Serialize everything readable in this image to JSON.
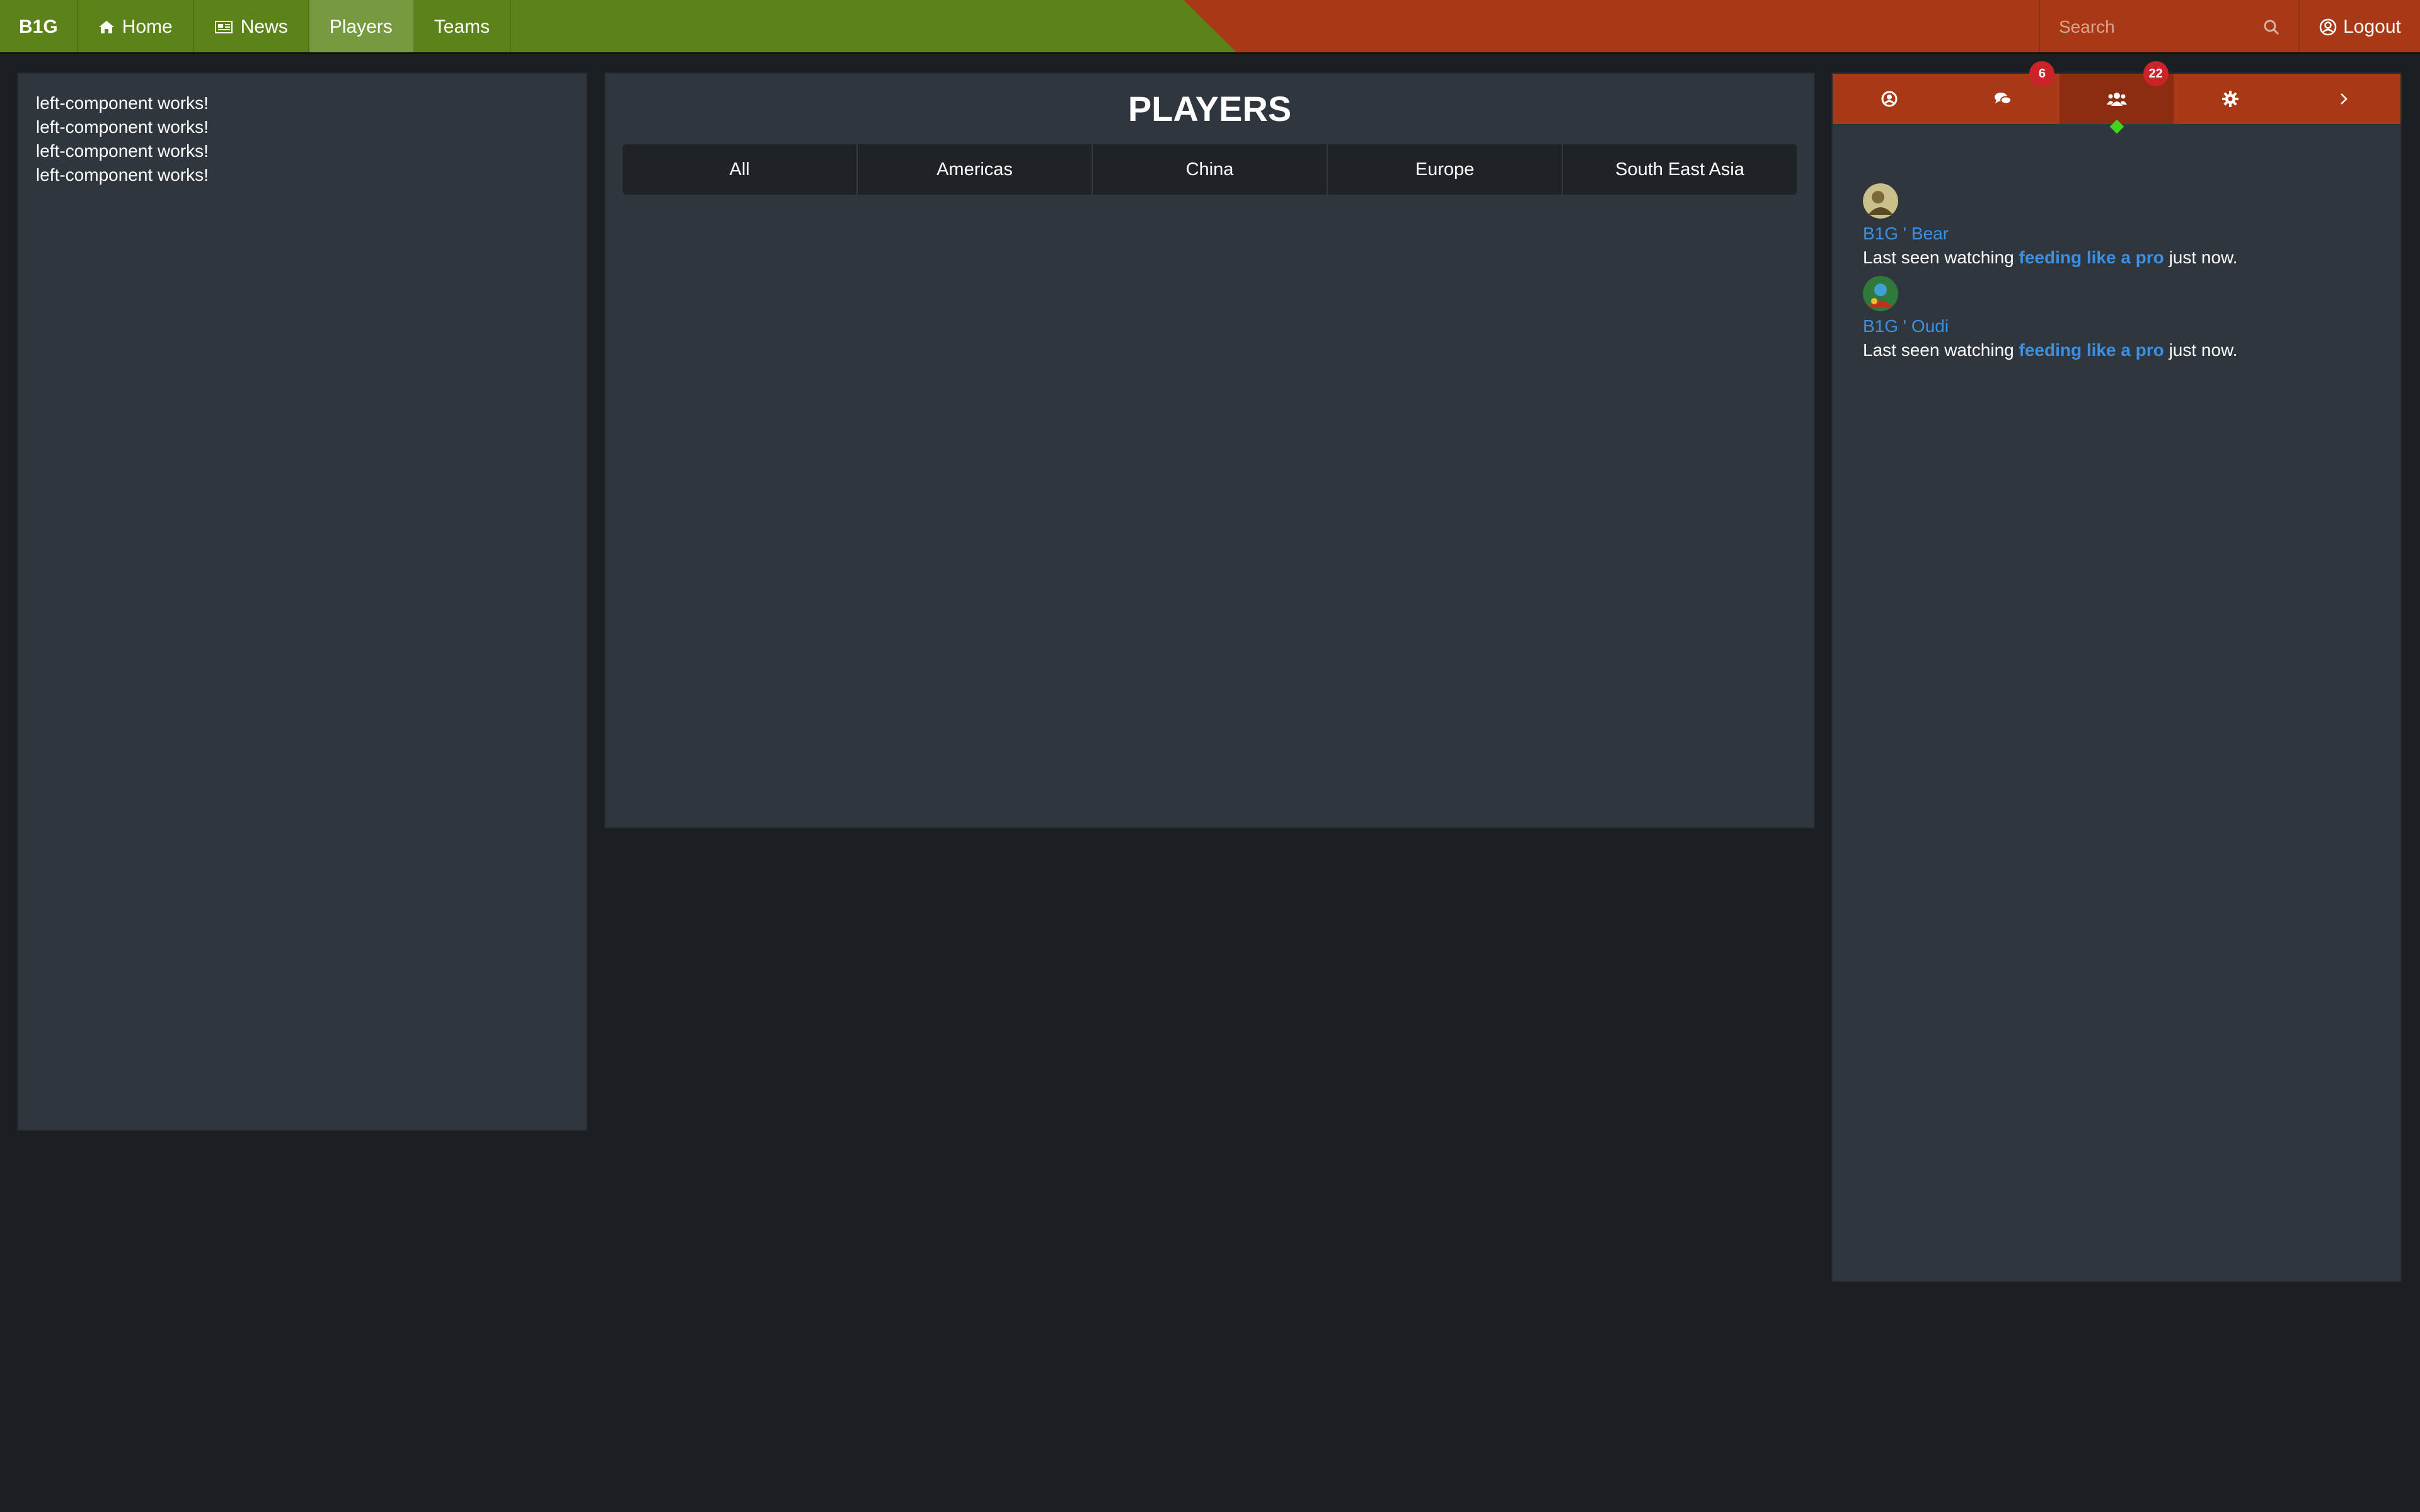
{
  "nav": {
    "brand": "B1G",
    "items": [
      {
        "label": "Home",
        "icon": "home-icon"
      },
      {
        "label": "News",
        "icon": "newspaper-icon"
      },
      {
        "label": "Players",
        "active": true
      },
      {
        "label": "Teams"
      }
    ],
    "search_placeholder": "Search",
    "logout_label": "Logout"
  },
  "colors": {
    "nav_green": "#5b831a",
    "nav_orange": "#a93916",
    "active_green": "#77993f",
    "panel": "#30363d",
    "background": "#1b1f22",
    "link_blue": "#3d8fe0",
    "badge_red": "#cc2229",
    "online_green": "#45d11f"
  },
  "left_panel": {
    "lines": [
      "left-component works!",
      "left-component works!",
      "left-component works!",
      "left-component works!"
    ]
  },
  "main": {
    "title": "PLAYERS",
    "tabs": [
      "All",
      "Americas",
      "China",
      "Europe",
      "South East Asia"
    ]
  },
  "sidebar": {
    "tabs": [
      {
        "icon": "user-circle-icon"
      },
      {
        "icon": "chat-bubbles-icon",
        "badge": "6"
      },
      {
        "icon": "users-icon",
        "badge": "22",
        "active": true
      },
      {
        "icon": "gear-icon"
      },
      {
        "icon": "chevron-right-icon"
      }
    ],
    "friends": [
      {
        "name": "B1G ' Bear",
        "status_prefix": "Last seen watching",
        "link": "feeding like a pro",
        "status_suffix": "just now."
      },
      {
        "name": "B1G ' Oudi",
        "status_prefix": "Last seen watching",
        "link": "feeding like a pro",
        "status_suffix": "just now."
      }
    ]
  }
}
